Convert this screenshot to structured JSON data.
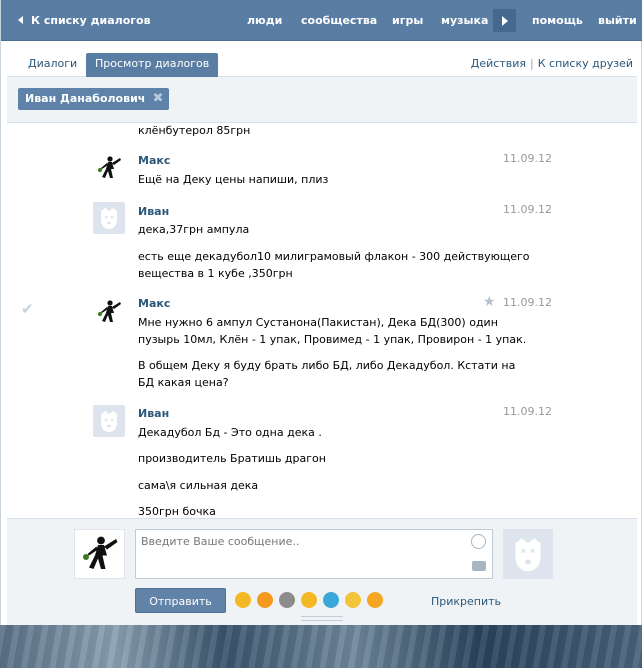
{
  "topnav": {
    "back_label": "К списку диалогов",
    "items": [
      "люди",
      "сообщества",
      "игры",
      "музыка",
      "помощь",
      "выйти"
    ]
  },
  "tabs": {
    "items": [
      "Диалоги",
      "Просмотр диалогов"
    ],
    "active": "Просмотр диалогов",
    "right_links": [
      "Действия",
      "К списку друзей"
    ]
  },
  "filter": {
    "chip_label": "Иван Данаболович",
    "chip_close": "✖"
  },
  "messages": {
    "partial_line": "клёнбутерол 85грн",
    "items": [
      {
        "author": "Макс",
        "date": "11.09.12",
        "avatar": "max",
        "lines": [
          "Ещё на Деку цены напиши, плиз"
        ]
      },
      {
        "author": "Иван",
        "date": "11.09.12",
        "avatar": "dog",
        "lines": [
          "дека,37грн ампула",
          "есть еще декадубол10 милиграмовый флакон - 300 действующего",
          "вещества в 1 кубе ,350грн"
        ]
      },
      {
        "author": "Макс",
        "date": "11.09.12",
        "avatar": "max",
        "lines": [
          "Мне нужно 6 ампул Сустанона(Пакистан), Дека БД(300) один",
          "пузырь 10мл, Клён - 1 упак, Провимед - 1 упак, Провирон - 1 упак.",
          "В общем Деку я буду брать либо БД, либо Декадубол. Кстати на",
          "БД какая цена?"
        ]
      },
      {
        "author": "Иван",
        "date": "11.09.12",
        "avatar": "dog",
        "lines": [
          "Декадубол Бд - Это одна дека .",
          "производитель Братишь драгон",
          "сама\\я сильная дека",
          "350грн бочка"
        ]
      }
    ]
  },
  "composer": {
    "placeholder": "Введите Ваше сообщение..",
    "send_label": "Отправить",
    "attach_label": "Прикрепить"
  },
  "colors": {
    "nav_bg": "#597da3",
    "link": "#2b587a",
    "panel_bg": "#f0f3f6",
    "button_bg": "#6283a8"
  }
}
